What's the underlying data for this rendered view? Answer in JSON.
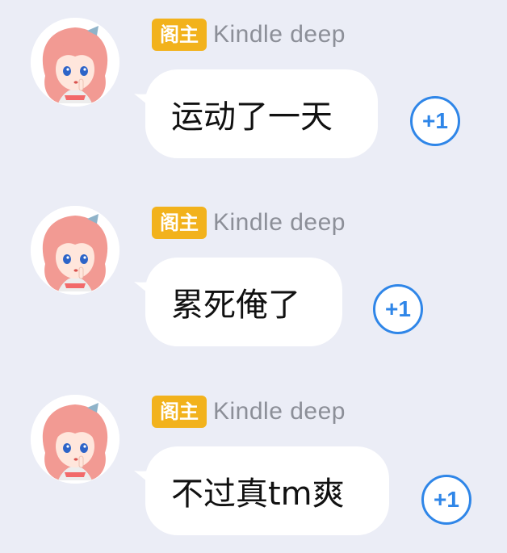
{
  "messages": [
    {
      "badge": "阁主",
      "username": "Kindle deep",
      "text": "运动了一天",
      "plus_one": "+1"
    },
    {
      "badge": "阁主",
      "username": "Kindle deep",
      "text": "累死俺了",
      "plus_one": "+1"
    },
    {
      "badge": "阁主",
      "username": "Kindle deep",
      "text": "不过真tm爽",
      "plus_one": "+1"
    }
  ],
  "colors": {
    "background": "#ebedf6",
    "badge": "#f2b21c",
    "username": "#8c8f98",
    "plus_one_accent": "#2f86e8"
  },
  "icons": {
    "avatar": "anime-girl-avatar",
    "plus_one": "plus-one-icon"
  }
}
